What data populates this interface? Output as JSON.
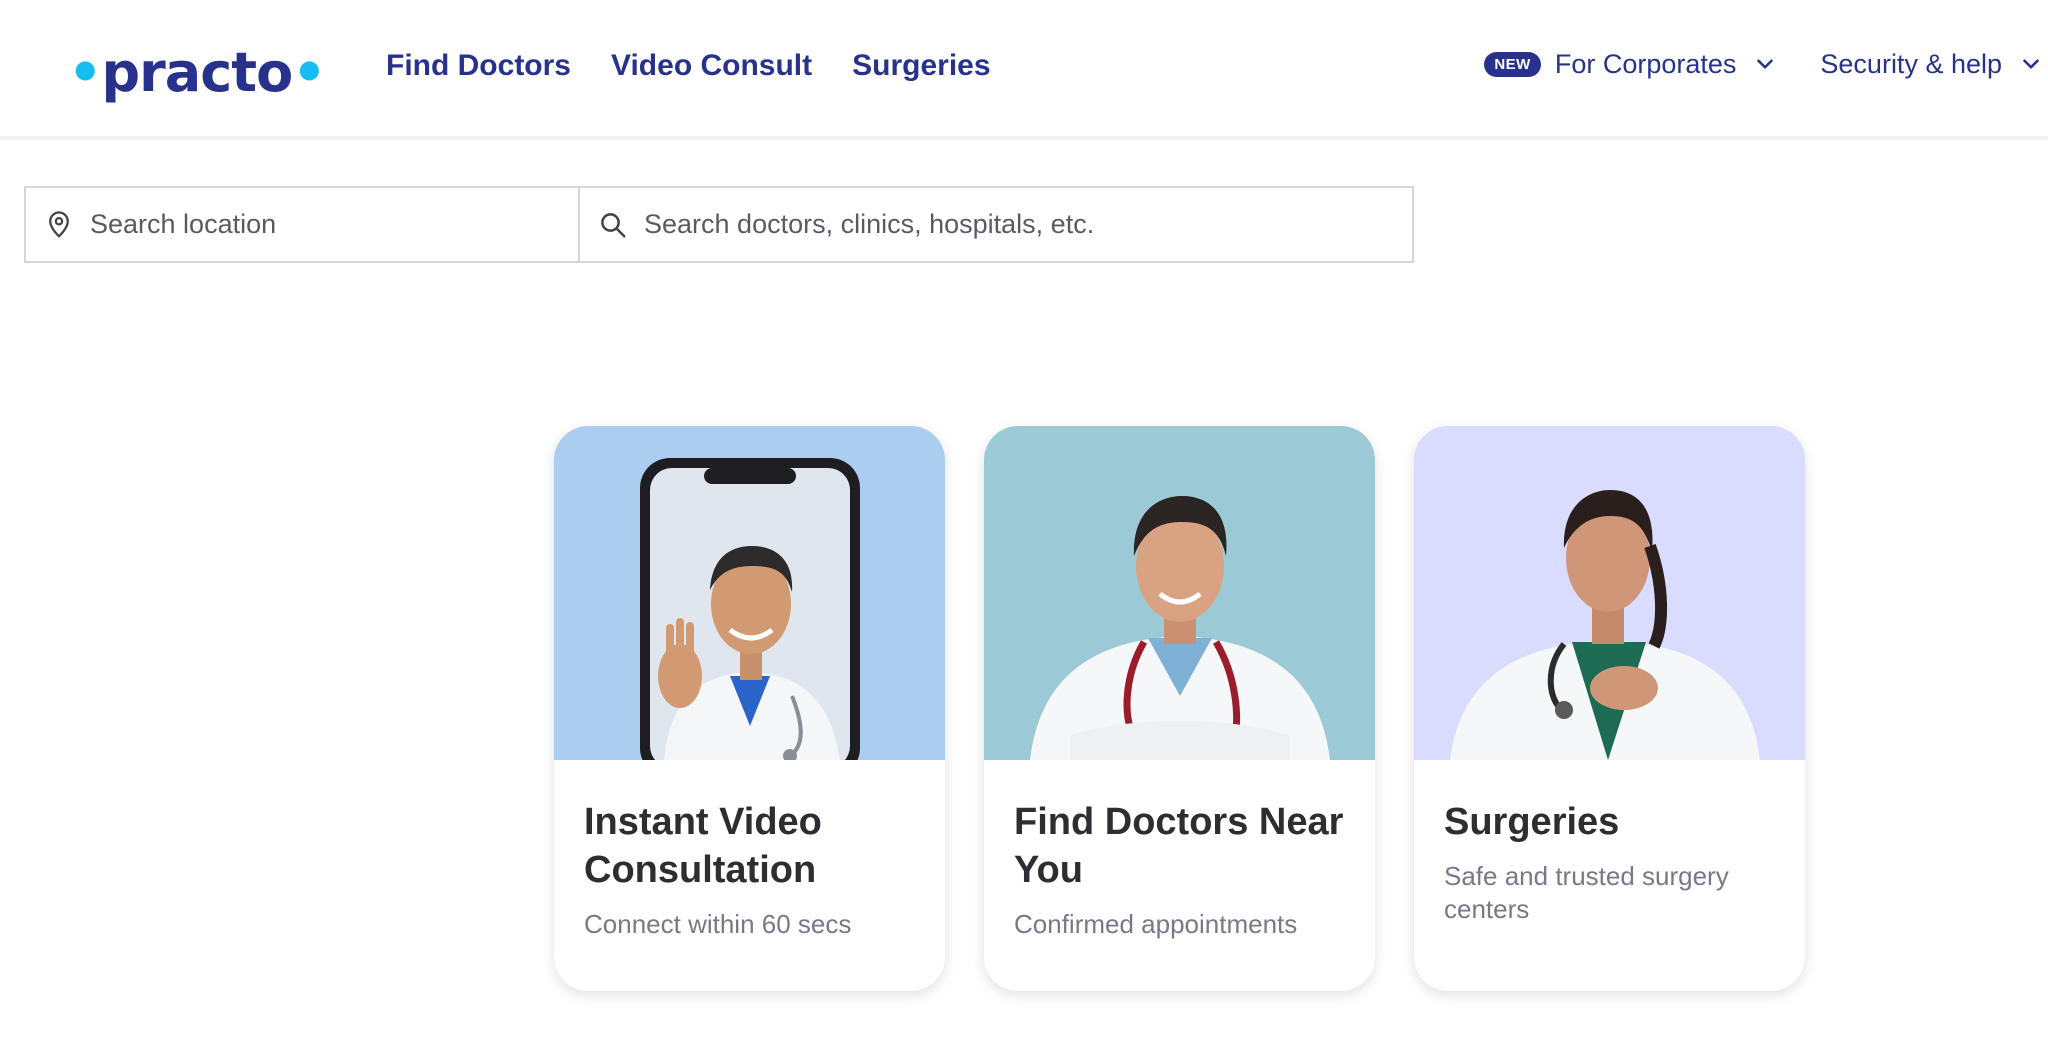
{
  "header": {
    "logo": {
      "word": "practo"
    },
    "nav": [
      {
        "label": "Find Doctors"
      },
      {
        "label": "Video Consult"
      },
      {
        "label": "Surgeries"
      }
    ],
    "corporates": {
      "badge": "NEW",
      "label": "For Corporates"
    },
    "security": {
      "label": "Security & help"
    }
  },
  "search": {
    "location_placeholder": "Search location",
    "query_placeholder": "Search doctors, clinics, hospitals, etc."
  },
  "cards": [
    {
      "title": "Instant Video Consultation",
      "subtitle": "Connect within 60 secs",
      "bg": "#abcdf0"
    },
    {
      "title": "Find Doctors Near You",
      "subtitle": "Confirmed appointments",
      "bg": "#9bcad6"
    },
    {
      "title": "Surgeries",
      "subtitle": "Safe and trusted surgery centers",
      "bg": "#d9dbff"
    }
  ],
  "colors": {
    "brand_navy": "#28328c",
    "brand_cyan": "#14bef0",
    "card_title": "#2d2d32",
    "card_sub": "#787887"
  }
}
